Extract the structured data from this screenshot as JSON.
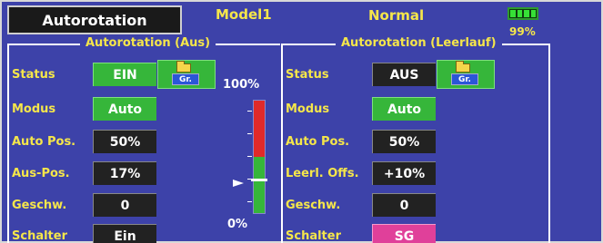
{
  "header": {
    "title": "Autorotation",
    "model": "Model1",
    "condition": "Normal",
    "battery_percent": "99%",
    "battery_level": 0.99
  },
  "left_panel": {
    "title": "Autorotation (Aus)",
    "rows": [
      {
        "label": "Status",
        "value": "EIN"
      },
      {
        "label": "Modus",
        "value": "Auto"
      },
      {
        "label": "Auto Pos.",
        "value": "50%"
      },
      {
        "label": "Aus-Pos.",
        "value": "17%"
      },
      {
        "label": "Geschw.",
        "value": "0"
      },
      {
        "label": "Schalter",
        "value": "Ein"
      }
    ],
    "group_button_label": "Gr.",
    "gauge": {
      "top_label": "100%",
      "bottom_label": "0%",
      "threshold_percent": 50,
      "pointer_percent": 30
    }
  },
  "right_panel": {
    "title": "Autorotation (Leerlauf)",
    "rows": [
      {
        "label": "Status",
        "value": "AUS"
      },
      {
        "label": "Modus",
        "value": "Auto"
      },
      {
        "label": "Auto Pos.",
        "value": "50%"
      },
      {
        "label": "Leerl. Offs.",
        "value": "+10%"
      },
      {
        "label": "Geschw.",
        "value": "0"
      },
      {
        "label": "Schalter",
        "value": "SG"
      }
    ],
    "group_button_label": "Gr."
  },
  "colors": {
    "background": "#3d42a9",
    "label_yellow": "#f5e64a",
    "active_green": "#36b63a",
    "switch_pink": "#e0409a",
    "gauge_red": "#e02a2a"
  },
  "icons": {
    "group": "folder-icon",
    "battery": "battery-icon",
    "pointer": "gauge-pointer-icon"
  }
}
